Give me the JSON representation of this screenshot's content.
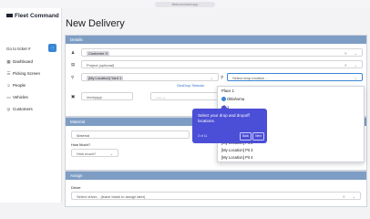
{
  "browser": {
    "url": "fleetcommand.app"
  },
  "sidebar": {
    "brand": "Fleet Command",
    "goto_label": "Go to ticket #",
    "goto_button": "→",
    "items": [
      {
        "label": "Dashboard",
        "icon": "dashboard-icon"
      },
      {
        "label": "Picking Screen",
        "icon": "picking-icon"
      },
      {
        "label": "People",
        "icon": "people-icon"
      },
      {
        "label": "Vehicles",
        "icon": "vehicles-icon"
      },
      {
        "label": "Customers",
        "icon": "customers-icon"
      }
    ]
  },
  "main": {
    "title": "New Delivery",
    "details": {
      "header": "Details",
      "customer_chip": "Customer X",
      "project_placeholder": "Project (optional)",
      "pickup_value": "[My Location] Yard 1",
      "drop_placeholder": "Select drop location ...",
      "geodrop_link": "GeoDrop Selector",
      "date_value": "/mm/yyyy",
      "time_value": "--:-- --"
    },
    "material": {
      "header": "Material",
      "material_placeholder": "Material",
      "how_much_label": "How Much?",
      "how_much_value": "How much?"
    },
    "assign": {
      "header": "Assign",
      "driver_label": "Driver",
      "driver_placeholder": "Select driver... (leave blank to assign later)"
    }
  },
  "dropdown": {
    "items": [
      "Place 1",
      "Oklahoma",
      "Pit 1",
      "[My Location] Pit 2",
      "[My Location] Pit 3",
      "[My Location] Pit 4"
    ]
  },
  "tooltip": {
    "text": "Select your drop and dropoff locations.",
    "step": "3 of 11",
    "back": "Back",
    "next": "Next"
  }
}
